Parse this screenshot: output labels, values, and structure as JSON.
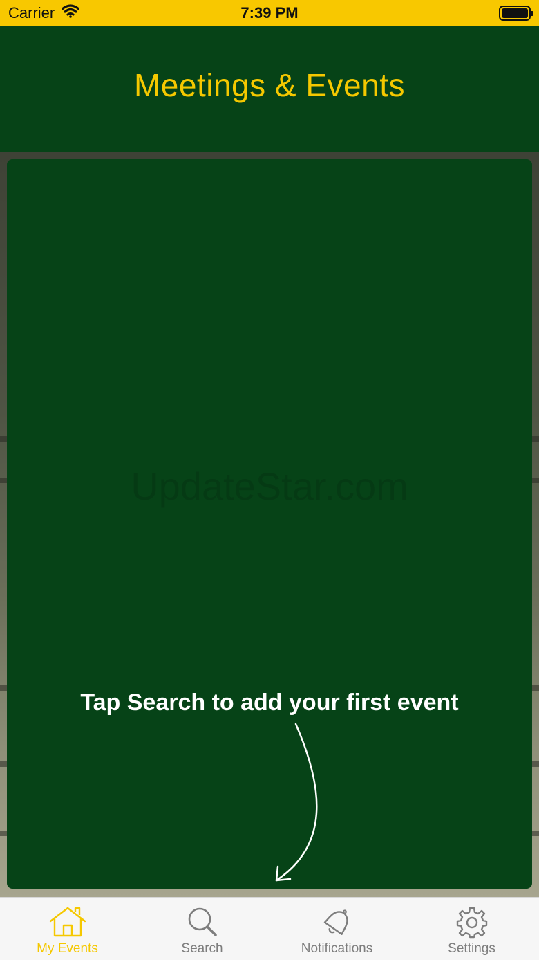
{
  "status_bar": {
    "carrier": "Carrier",
    "time": "7:39 PM",
    "wifi_icon": "wifi-icon",
    "battery_icon": "battery-icon"
  },
  "header": {
    "title": "Meetings & Events"
  },
  "content": {
    "watermark": "UpdateStar.com",
    "hint": "Tap Search to add your first event",
    "arrow_icon": "curved-arrow-icon"
  },
  "tabs": [
    {
      "label": "My Events",
      "icon": "home-icon",
      "active": true
    },
    {
      "label": "Search",
      "icon": "search-icon",
      "active": false
    },
    {
      "label": "Notifications",
      "icon": "bell-icon",
      "active": false
    },
    {
      "label": "Settings",
      "icon": "gear-icon",
      "active": false
    }
  ],
  "colors": {
    "status_bar": "#f8c800",
    "brand_green": "#064317",
    "accent_yellow": "#f5c800",
    "tab_inactive": "#7d7d7d"
  }
}
